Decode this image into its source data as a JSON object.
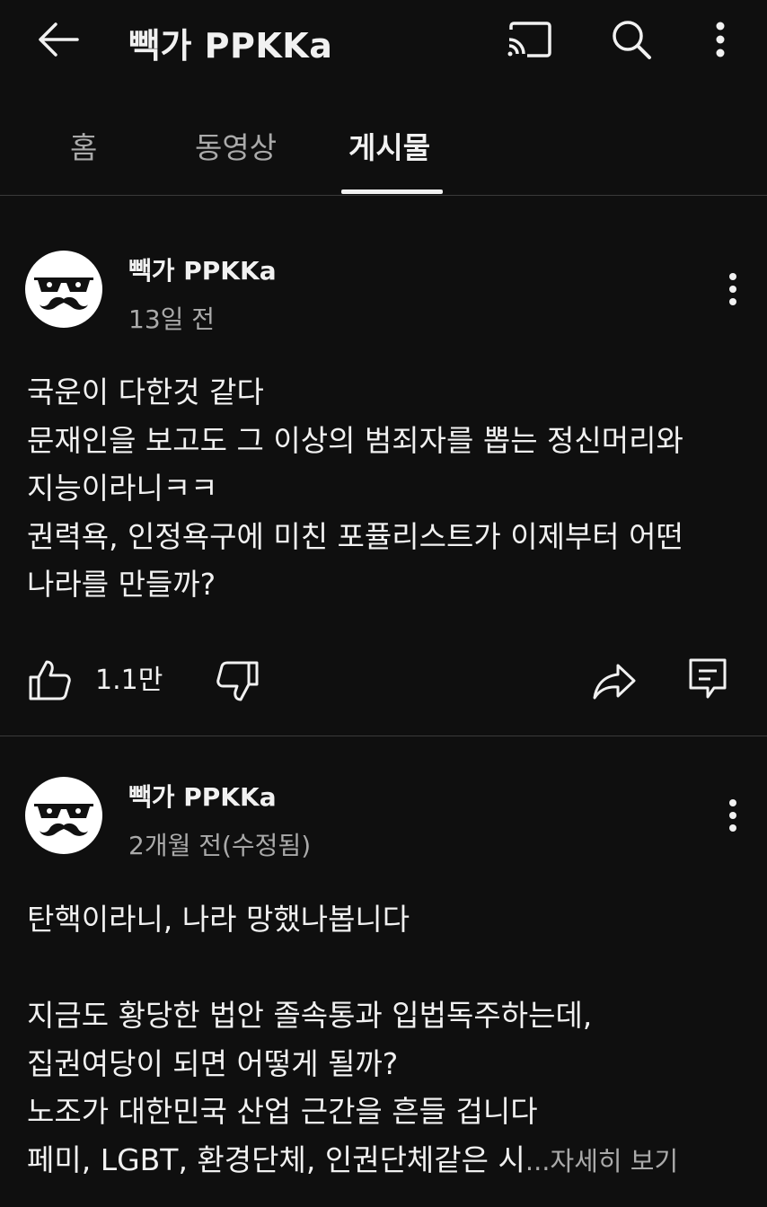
{
  "header": {
    "title": "빽가 PPKKa",
    "icons": [
      "back-arrow-icon",
      "cast-icon",
      "search-icon",
      "more-vertical-icon"
    ]
  },
  "tabs": [
    {
      "label": "홈",
      "active": false
    },
    {
      "label": "동영상",
      "active": false
    },
    {
      "label": "게시물",
      "active": true
    }
  ],
  "posts": [
    {
      "author": "빽가 PPKKa",
      "time": "13일 전",
      "lines": [
        "국운이 다한것 같다",
        "문재인을 보고도 그 이상의 범죄자를 뽑는 정신머리와",
        "지능이라니ㅋㅋ",
        "권력욕, 인정욕구에 미친 포퓰리스트가 이제부터 어떤",
        "나라를 만들까?"
      ],
      "likes": "1.1만"
    },
    {
      "author": "빽가 PPKKa",
      "time": "2개월 전(수정됨)",
      "lines": [
        "탄핵이라니, 나라 망했나봅니다",
        "",
        "지금도 황당한 법안 졸속통과 입법독주하는데,",
        "집권여당이 되면 어떻게 될까?",
        "노조가 대한민국 산업 근간을 흔들 겁니다",
        "페미, LGBT, 환경단체, 인권단체같은 시"
      ],
      "ellipsis": "...",
      "read_more": "자세히 보기"
    }
  ],
  "colors": {
    "background": "#0f0f0f",
    "text": "#f1f1f1",
    "secondary": "#aaaaaa",
    "divider": "#3a3a3a"
  }
}
